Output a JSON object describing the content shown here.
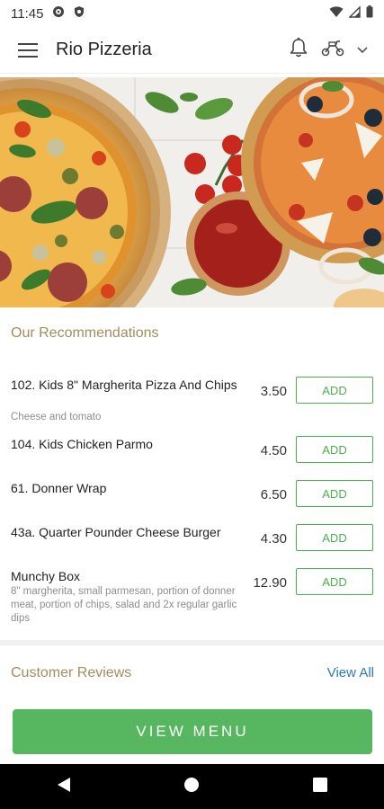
{
  "status": {
    "time": "11:45"
  },
  "header": {
    "title": "Rio Pizzeria"
  },
  "recommendations": {
    "title": "Our Recommendations",
    "items": [
      {
        "name": "102. Kids 8\" Margherita Pizza And Chips",
        "desc": "Cheese and tomato",
        "price": "3.50",
        "button": "ADD"
      },
      {
        "name": "104. Kids Chicken Parmo",
        "desc": "",
        "price": "4.50",
        "button": "ADD"
      },
      {
        "name": "61. Donner Wrap",
        "desc": "",
        "price": "6.50",
        "button": "ADD"
      },
      {
        "name": "43a. Quarter Pounder Cheese Burger",
        "desc": "",
        "price": "4.30",
        "button": "ADD"
      },
      {
        "name": "Munchy Box",
        "desc": "8\" margherita, small parmesan, portion of donner meat, portion of chips, salad and 2x regular  garlic dips",
        "price": "12.90",
        "button": "ADD"
      }
    ]
  },
  "reviews": {
    "title": "Customer Reviews",
    "view_all": "View All"
  },
  "cta": {
    "label": "VIEW MENU"
  },
  "colors": {
    "accent": "#57b760",
    "section": "#a38c5e",
    "link": "#2b7ab5"
  },
  "icons": [
    "settings-icon",
    "shield-icon",
    "wifi-icon",
    "signal-icon",
    "battery-icon",
    "menu-icon",
    "bell-icon",
    "scooter-icon",
    "chevron-down-icon",
    "back-icon",
    "home-icon",
    "recents-icon"
  ]
}
